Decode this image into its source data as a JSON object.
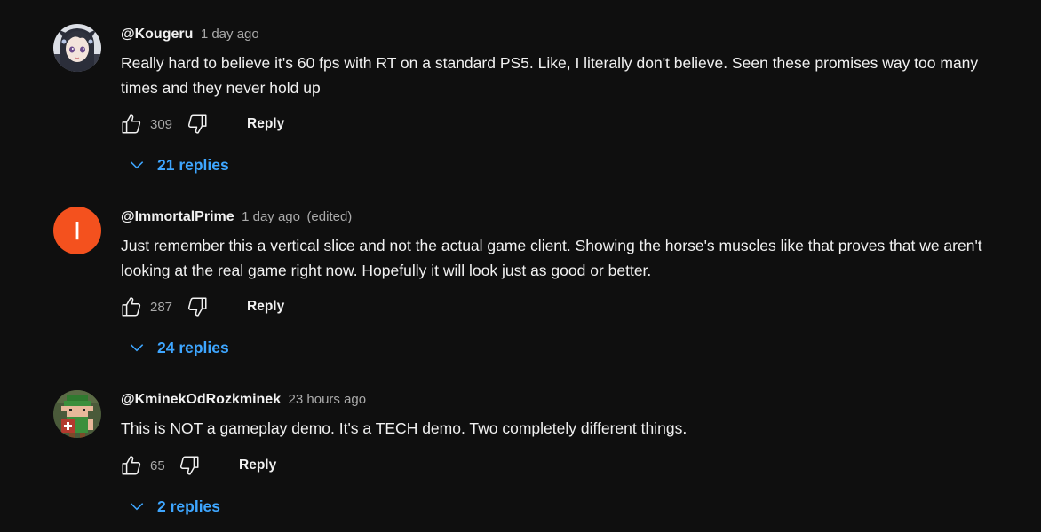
{
  "comments": [
    {
      "author": "@Kougeru",
      "time": "1 day ago",
      "edited": "",
      "avatar": {
        "type": "anime-girl-avatar"
      },
      "text": "Really hard to believe it's 60 fps with RT on a standard PS5. Like, I literally don't believe. Seen these promises way too many times and they never hold up",
      "likes": "309",
      "reply_label": "Reply",
      "replies_label": "21 replies"
    },
    {
      "author": "@ImmortalPrime",
      "time": "1 day ago",
      "edited": "(edited)",
      "avatar": {
        "type": "letter",
        "letter": "I",
        "color": "#f4511e"
      },
      "text": "Just remember this a vertical slice and not the actual game client. Showing the horse's muscles like that proves that we aren't looking at the real game right now. Hopefully it will look just as good or better.",
      "likes": "287",
      "reply_label": "Reply",
      "replies_label": "24 replies"
    },
    {
      "author": "@KminekOdRozkminek",
      "time": "23 hours ago",
      "edited": "",
      "avatar": {
        "type": "pixel-art-elf-avatar"
      },
      "text": "This is NOT a gameplay demo. It's a TECH demo. Two completely different things.",
      "likes": "65",
      "reply_label": "Reply",
      "replies_label": "2 replies"
    }
  ],
  "colors": {
    "background": "#0f0f0f",
    "text": "#f1f1f1",
    "secondary_text": "#aaaaaa",
    "link_blue": "#3ea6ff"
  }
}
